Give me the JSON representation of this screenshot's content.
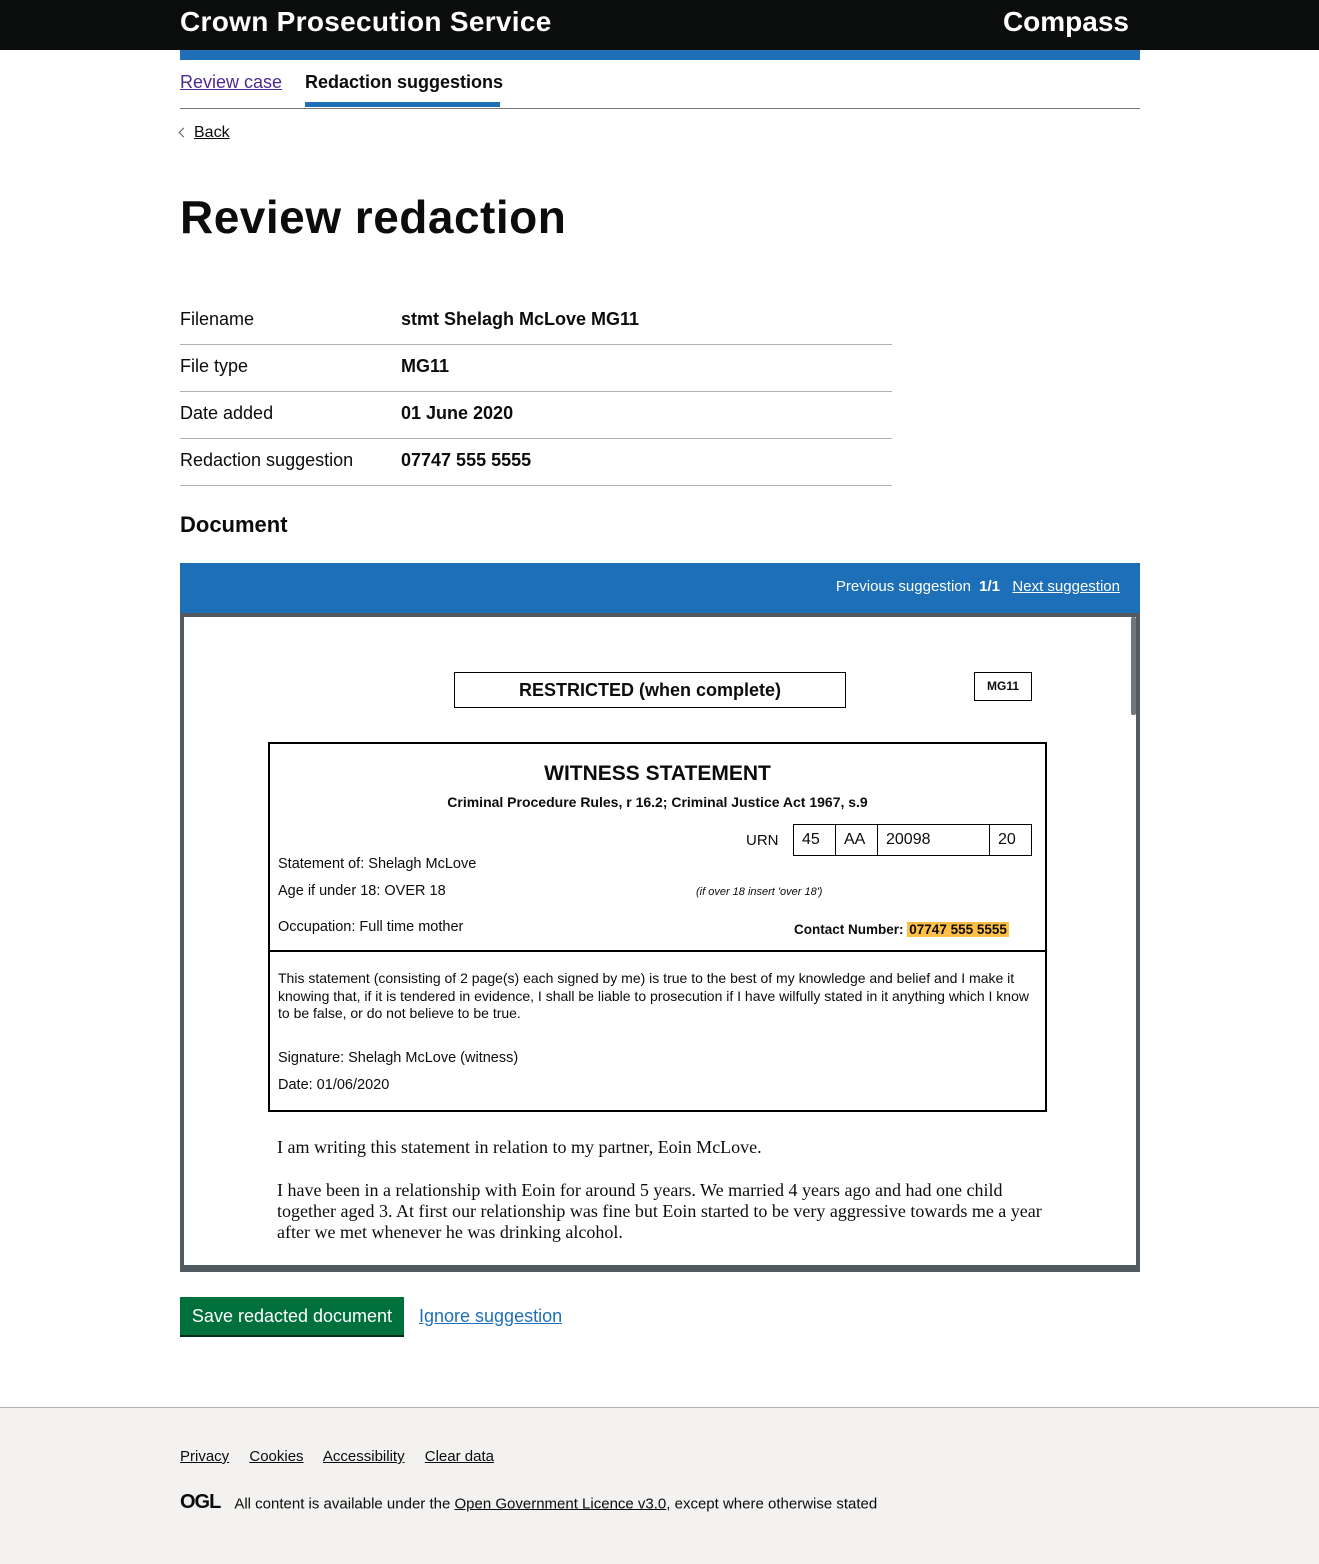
{
  "header": {
    "service_name": "Crown Prosecution Service",
    "product_name": "Compass"
  },
  "subnav": {
    "tabs": [
      {
        "label": "Review case",
        "active": false
      },
      {
        "label": "Redaction suggestions",
        "active": true
      }
    ]
  },
  "back_label": "Back",
  "page_title": "Review redaction",
  "summary": [
    {
      "key": "Filename",
      "value": "stmt Shelagh McLove MG11"
    },
    {
      "key": "File type",
      "value": "MG11"
    },
    {
      "key": "Date added",
      "value": "01 June 2020"
    },
    {
      "key": "Redaction suggestion",
      "value": "07747 555 5555"
    }
  ],
  "document_heading": "Document",
  "viewer": {
    "previous_label": "Previous suggestion",
    "count": "1/1",
    "next_label": "Next suggestion"
  },
  "doc": {
    "restricted": "RESTRICTED (when complete)",
    "form_code": "MG11",
    "title": "WITNESS STATEMENT",
    "subtitle": "Criminal Procedure Rules, r 16.2; Criminal Justice Act 1967, s.9",
    "urn_label": "URN",
    "urn": [
      "45",
      "AA",
      "20098",
      "20"
    ],
    "statement_of": "Statement of: Shelagh McLove",
    "age": "Age if under 18: OVER 18",
    "age_hint": "(if over 18 insert 'over 18')",
    "occupation": "Occupation:  Full time mother",
    "contact_label": "Contact Number:",
    "contact_value": "07747 555 5555",
    "declaration": "This statement (consisting of 2 page(s) each signed by me) is true to the best of my knowledge and belief and I make it knowing that, if it is tendered in evidence, I shall be liable to prosecution if I have wilfully stated in it anything which I know to be false, or do not believe to be true.",
    "signature": "Signature: Shelagh McLove (witness)",
    "date": "Date:  01/06/2020",
    "paragraph1": "I am writing this statement in relation to my partner, Eoin McLove.",
    "paragraph2": "I have been in a relationship with Eoin for around 5 years. We married 4 years ago and had one child together aged 3. At first our relationship was fine but Eoin started to be very aggressive towards me a year after we met whenever he was drinking alcohol."
  },
  "actions": {
    "save_label": "Save redacted document",
    "ignore_label": "Ignore suggestion"
  },
  "footer": {
    "links": [
      "Privacy",
      "Cookies",
      "Accessibility",
      "Clear data"
    ],
    "ogl_logo": "OGL",
    "licence_prefix": "All content is available under the ",
    "licence_link": "Open Government Licence v3.0",
    "licence_suffix": ", except where otherwise stated"
  },
  "colors": {
    "brand_blue": "#1d70b8",
    "button_green": "#00703c",
    "highlight": "#ffbf47",
    "header_black": "#0b0c0c"
  }
}
